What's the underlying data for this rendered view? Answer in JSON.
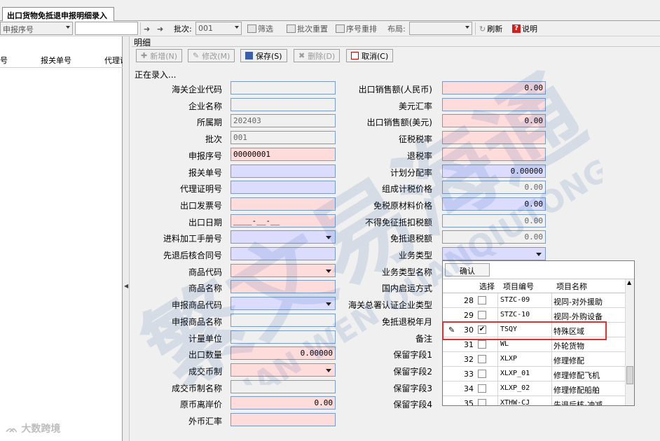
{
  "tab": {
    "title": "出口货物免抵退申报明细录入"
  },
  "toolbar": {
    "filter_combo": "申报序号",
    "batch_label": "批次:",
    "batch_value": "001",
    "filter_label": "筛选",
    "batch_reset_label": "批次重置",
    "seq_reset_label": "序号重排",
    "layout_label": "布局:",
    "refresh_label": "刷新",
    "help_label": "说明"
  },
  "left": {
    "col1": "号",
    "col2": "报关单号",
    "col3": "代理证"
  },
  "detail": {
    "section": "明细",
    "status": "正在录入...",
    "buttons": {
      "add": "新增(N)",
      "edit": "修改(M)",
      "save": "保存(S)",
      "delete": "删除(D)",
      "cancel": "取消(C)"
    }
  },
  "form_left": [
    {
      "label": "海关企业代码",
      "value": "",
      "style": "gray"
    },
    {
      "label": "企业名称",
      "value": "",
      "style": "gray"
    },
    {
      "label": "所属期",
      "value": "202403",
      "style": "gray"
    },
    {
      "label": "批次",
      "value": "001",
      "style": "gray"
    },
    {
      "label": "申报序号",
      "value": "00000001",
      "style": "pink"
    },
    {
      "label": "报关单号",
      "value": "",
      "style": "blue"
    },
    {
      "label": "代理证明号",
      "value": "",
      "style": "blue"
    },
    {
      "label": "出口发票号",
      "value": "",
      "style": "pink"
    },
    {
      "label": "出口日期",
      "value": "____-__-__",
      "style": "pink"
    },
    {
      "label": "进料加工手册号",
      "value": "",
      "style": "blue",
      "dropdown": true
    },
    {
      "label": "先退后核合同号",
      "value": "",
      "style": "blue"
    },
    {
      "label": "商品代码",
      "value": "",
      "style": "pink",
      "dropdown": true
    },
    {
      "label": "商品名称",
      "value": "",
      "style": "pink"
    },
    {
      "label": "申报商品代码",
      "value": "",
      "style": "blue",
      "dropdown": true
    },
    {
      "label": "申报商品名称",
      "value": "",
      "style": "gray"
    },
    {
      "label": "计量单位",
      "value": "",
      "style": "gray"
    },
    {
      "label": "出口数量",
      "value": "0.00000",
      "style": "pink",
      "num": true
    },
    {
      "label": "成交币制",
      "value": "",
      "style": "pink",
      "dropdown": true
    },
    {
      "label": "成交币制名称",
      "value": "",
      "style": "gray"
    },
    {
      "label": "原币离岸价",
      "value": "0.00",
      "style": "pink",
      "num": true
    },
    {
      "label": "外币汇率",
      "value": "",
      "style": "pink"
    }
  ],
  "form_right": [
    {
      "label": "出口销售额(人民币)",
      "value": "0.00",
      "style": "pink",
      "num": true
    },
    {
      "label": "美元汇率",
      "value": "",
      "style": "pink"
    },
    {
      "label": "出口销售额(美元)",
      "value": "0.00",
      "style": "pink",
      "num": true
    },
    {
      "label": "征税税率",
      "value": "",
      "style": "pink"
    },
    {
      "label": "退税率",
      "value": "",
      "style": "pink"
    },
    {
      "label": "计划分配率",
      "value": "0.00000",
      "style": "blue",
      "num": true
    },
    {
      "label": "组成计税价格",
      "value": "0.00",
      "style": "gray",
      "num": true
    },
    {
      "label": "免税原材料价格",
      "value": "0.00",
      "style": "blue",
      "num": true
    },
    {
      "label": "不得免征抵扣税额",
      "value": "0.00",
      "style": "gray",
      "num": true
    },
    {
      "label": "免抵退税额",
      "value": "0.00",
      "style": "gray",
      "num": true
    },
    {
      "label": "业务类型",
      "value": "",
      "style": "blue",
      "dropdown": true
    },
    {
      "label": "业务类型名称",
      "value": ""
    },
    {
      "label": "国内启运方式",
      "value": ""
    },
    {
      "label": "海关总署认证企业类型",
      "value": ""
    },
    {
      "label": "免抵退税年月",
      "value": ""
    },
    {
      "label": "备注",
      "value": ""
    },
    {
      "label": "保留字段1",
      "value": ""
    },
    {
      "label": "保留字段2",
      "value": ""
    },
    {
      "label": "保留字段3",
      "value": ""
    },
    {
      "label": "保留字段4",
      "value": ""
    }
  ],
  "popup": {
    "confirm_label": "确认",
    "headers": {
      "select": "选择",
      "code": "项目编号",
      "name": "项目名称"
    },
    "rows": [
      {
        "no": "28",
        "checked": false,
        "code": "STZC-09",
        "name": "视同-对外援助"
      },
      {
        "no": "29",
        "checked": false,
        "code": "STZC-10",
        "name": "视同-外购设备"
      },
      {
        "no": "30",
        "checked": true,
        "code": "TSQY",
        "name": "特殊区域",
        "current": true
      },
      {
        "no": "31",
        "checked": false,
        "code": "WL",
        "name": "外轮货物"
      },
      {
        "no": "32",
        "checked": false,
        "code": "XLXP",
        "name": "修理修配"
      },
      {
        "no": "33",
        "checked": false,
        "code": "XLXP_01",
        "name": "修理修配飞机"
      },
      {
        "no": "34",
        "checked": false,
        "code": "XLXP_02",
        "name": "修理修配船舶"
      },
      {
        "no": "35",
        "checked": false,
        "code": "XTHW-CJ",
        "name": "先退后核-冲减"
      }
    ]
  },
  "watermark": {
    "main": "繁文易海通",
    "sub": "QIAN WEN QUANQIUTONG",
    "brand": "大数跨境"
  },
  "colors": {
    "pink": "#ffdcdc",
    "blue": "#dcdcff",
    "highlight": "#e03030"
  }
}
